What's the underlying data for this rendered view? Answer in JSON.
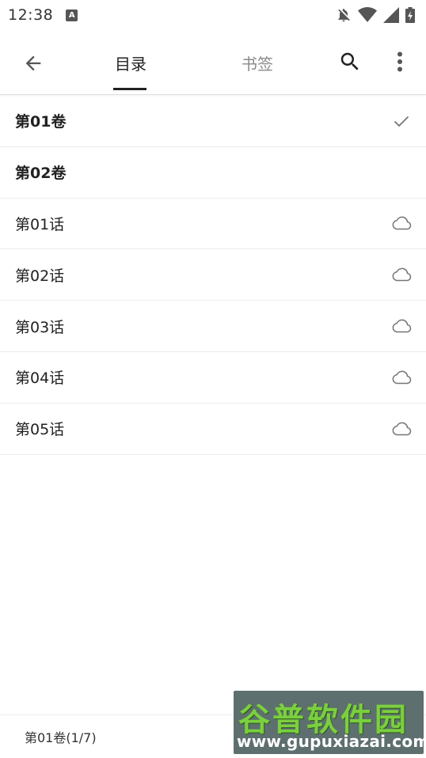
{
  "status_bar": {
    "time": "12:38",
    "notification_icon": "A"
  },
  "app_bar": {
    "tabs": [
      {
        "label": "目录",
        "active": true
      },
      {
        "label": "书签",
        "active": false
      }
    ]
  },
  "list": {
    "items": [
      {
        "label": "第01卷",
        "type": "volume",
        "icon": "check-icon"
      },
      {
        "label": "第02卷",
        "type": "volume",
        "icon": ""
      },
      {
        "label": "第01话",
        "type": "chapter",
        "icon": "cloud-icon"
      },
      {
        "label": "第02话",
        "type": "chapter",
        "icon": "cloud-icon"
      },
      {
        "label": "第03话",
        "type": "chapter",
        "icon": "cloud-icon"
      },
      {
        "label": "第04话",
        "type": "chapter",
        "icon": "cloud-icon"
      },
      {
        "label": "第05话",
        "type": "chapter",
        "icon": "cloud-icon"
      }
    ]
  },
  "footer": {
    "position_text": "第01卷(1/7)"
  },
  "watermark": {
    "title": "谷普软件园",
    "url": "www.gupuxiazai.com"
  },
  "colors": {
    "accent": "#212121",
    "inactive_tab": "#8a8a8a",
    "icon_gray": "#757575",
    "watermark_green": "#7bcf3f"
  }
}
